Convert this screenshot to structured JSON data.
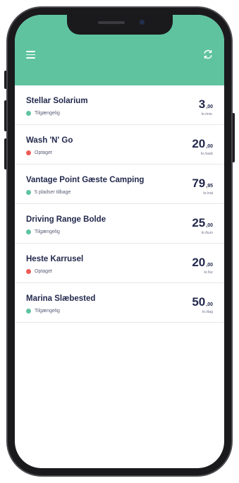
{
  "colors": {
    "header": "#5fc3a0",
    "available": "#5fc3a0",
    "occupied": "#ee5b58",
    "title_text": "#23294d"
  },
  "header": {
    "menu_icon": "hamburger-menu-icon",
    "refresh_icon": "refresh-icon"
  },
  "items": [
    {
      "title": "Stellar Solarium",
      "status": "Tilgængelig",
      "status_type": "available",
      "price_int": "3",
      "price_dec": ",00",
      "unit": "kr./min."
    },
    {
      "title": "Wash 'N' Go",
      "status": "Optaget",
      "status_type": "occupied",
      "price_int": "20",
      "price_dec": ",00",
      "unit": "kr./vask"
    },
    {
      "title": "Vantage Point Gæste Camping",
      "status": "5 pladser tilbage",
      "status_type": "available",
      "price_int": "79",
      "price_dec": ",95",
      "unit": "kr./nat"
    },
    {
      "title": "Driving Range Bolde",
      "status": "Tilgængelig",
      "status_type": "available",
      "price_int": "25",
      "price_dec": ",00",
      "unit": "kr./kurv"
    },
    {
      "title": "Heste Karrusel",
      "status": "Optaget",
      "status_type": "occupied",
      "price_int": "20",
      "price_dec": ",00",
      "unit": "kr./tur"
    },
    {
      "title": "Marina Slæbested",
      "status": "Tilgængelig",
      "status_type": "available",
      "price_int": "50",
      "price_dec": ",00",
      "unit": "kr./dag"
    }
  ]
}
